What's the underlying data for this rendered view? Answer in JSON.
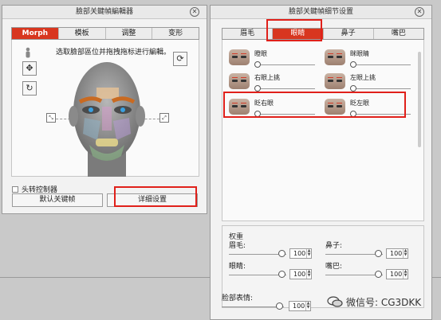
{
  "left_window": {
    "title": "臉部关鍵幀編輯器",
    "tabs": [
      "Morph",
      "模板",
      "调整",
      "变形"
    ],
    "hint": "选取臉部區位并拖拽拖标进行編輯。",
    "checkbox_label": "头转控制器",
    "btn_default": "默认关键帧",
    "btn_detail": "详细设置"
  },
  "right_window": {
    "title": "臉部关鍵幀细节设置",
    "tabs": [
      "眉毛",
      "眼睛",
      "鼻子",
      "嘴巴"
    ],
    "items": [
      {
        "label": "瞪眼"
      },
      {
        "label": "眯眼睛"
      },
      {
        "label": "右眼上挑"
      },
      {
        "label": "左眼上挑"
      },
      {
        "label": "眨右眼"
      },
      {
        "label": "眨左眼"
      }
    ],
    "weight": {
      "title": "权重",
      "rows": [
        {
          "label": "眉毛:",
          "value": "100"
        },
        {
          "label": "鼻子:",
          "value": "100"
        },
        {
          "label": "眼睛:",
          "value": "100"
        },
        {
          "label": "嘴巴:",
          "value": "100"
        },
        {
          "label": "脸部表情:",
          "value": "100"
        }
      ]
    }
  },
  "watermark": {
    "text": "微信号: CG3DKK"
  },
  "colors": {
    "accent": "#d8361f",
    "highlight_box": "#e0201a"
  }
}
